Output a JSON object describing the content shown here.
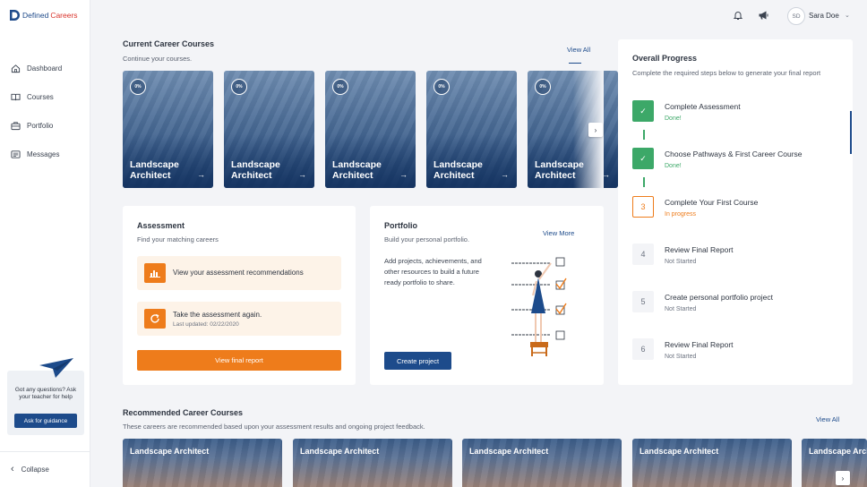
{
  "brand": {
    "name_part1": "Defined",
    "name_part2": "Careers"
  },
  "sidebar": {
    "items": [
      {
        "label": "Dashboard",
        "icon": "home-icon"
      },
      {
        "label": "Courses",
        "icon": "book-icon"
      },
      {
        "label": "Portfolio",
        "icon": "briefcase-icon"
      },
      {
        "label": "Messages",
        "icon": "message-icon"
      }
    ],
    "help": {
      "text": "Got any questions? Ask your teacher for help",
      "button": "Ask for guidance"
    },
    "collapse_label": "Collapse"
  },
  "header": {
    "user_initials": "SD",
    "user_name": "Sara Doe"
  },
  "current_courses": {
    "title": "Current Career Courses",
    "subtitle": "Continue your courses.",
    "view_all": "View All",
    "cards": [
      {
        "progress": "0%",
        "title": "Landscape Architect"
      },
      {
        "progress": "0%",
        "title": "Landscape Architect"
      },
      {
        "progress": "0%",
        "title": "Landscape Architect"
      },
      {
        "progress": "0%",
        "title": "Landscape Architect"
      },
      {
        "progress": "0%",
        "title": "Landscape Architect"
      }
    ]
  },
  "assessment": {
    "title": "Assessment",
    "subtitle": "Find your matching careers",
    "item1": "View your assessment recommendations",
    "item2": "Take the assessment again.",
    "item2_sub": "Last updated: 02/22/2020",
    "button": "View final report"
  },
  "portfolio": {
    "title": "Portfolio",
    "subtitle": "Build your personal portfolio.",
    "view_more": "View More",
    "description": "Add projects, achievements, and other resources to build a future ready portfolio to share.",
    "button": "Create project"
  },
  "progress": {
    "title": "Overall Progress",
    "subtitle": "Complete the required steps below to generate your final report",
    "steps": [
      {
        "marker": "✓",
        "title": "Complete Assessment",
        "status": "Done!",
        "state": "done"
      },
      {
        "marker": "✓",
        "title": "Choose Pathways & First Career Course",
        "status": "Done!",
        "state": "done"
      },
      {
        "marker": "3",
        "title": "Complete Your First Course",
        "status": "In progress",
        "state": "progress"
      },
      {
        "marker": "4",
        "title": "Review Final Report",
        "status": "Not Started",
        "state": "todo"
      },
      {
        "marker": "5",
        "title": "Create personal portfolio project",
        "status": "Not Started",
        "state": "todo"
      },
      {
        "marker": "6",
        "title": "Review Final Report",
        "status": "Not Started",
        "state": "todo"
      }
    ]
  },
  "recommended": {
    "title": "Recommended Career Courses",
    "subtitle": "These careers are recommended based upon your assessment results and ongoing project feedback.",
    "view_all": "View All",
    "cards": [
      {
        "title": "Landscape Architect"
      },
      {
        "title": "Landscape Architect"
      },
      {
        "title": "Landscape Architect"
      },
      {
        "title": "Landscape Architect"
      },
      {
        "title": "Landscape Architect"
      }
    ]
  },
  "colors": {
    "primary": "#1d4b8b",
    "accent": "#ee7c1b",
    "success": "#3ca868"
  }
}
